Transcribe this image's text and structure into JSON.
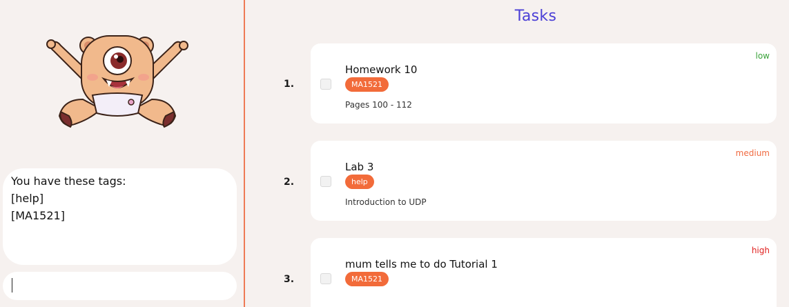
{
  "colors": {
    "accent": "#ee7a55",
    "tag_background": "#f26b3a",
    "title": "#4b3fd6",
    "priority_low": "#3aa33a",
    "priority_medium": "#f06a40",
    "priority_high": "#e0201e"
  },
  "left": {
    "mascot_icon": "mascot-icon",
    "response_lines": [
      "You have these tags:",
      "[help]",
      "[MA1521]"
    ],
    "command_input": {
      "value": "",
      "placeholder": ""
    }
  },
  "tasks": {
    "title": "Tasks",
    "items": [
      {
        "index": "1.",
        "name": "Homework 10",
        "tag": "MA1521",
        "description": "Pages 100 - 112",
        "priority": "low",
        "checked": false
      },
      {
        "index": "2.",
        "name": "Lab 3",
        "tag": "help",
        "description": "Introduction to UDP",
        "priority": "medium",
        "checked": false
      },
      {
        "index": "3.",
        "name": "mum tells me to do Tutorial 1",
        "tag": "MA1521",
        "description": "",
        "priority": "high",
        "checked": false
      }
    ]
  }
}
